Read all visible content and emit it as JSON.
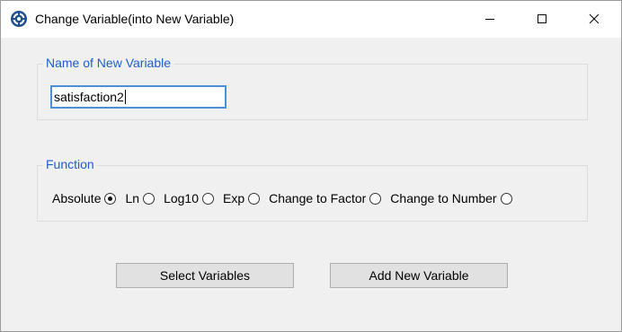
{
  "window": {
    "title": "Change Variable(into New Variable)",
    "icon": "app-gear-icon",
    "controls": [
      "minimize-icon",
      "maximize-icon",
      "close-icon"
    ]
  },
  "name_group": {
    "legend": "Name of New Variable",
    "input_value": "satisfaction2"
  },
  "function_group": {
    "legend": "Function",
    "options": [
      {
        "label": "Absolute",
        "checked": true
      },
      {
        "label": "Ln",
        "checked": false
      },
      {
        "label": "Log10",
        "checked": false
      },
      {
        "label": "Exp",
        "checked": false
      },
      {
        "label": "Change to Factor",
        "checked": false
      },
      {
        "label": "Change to Number",
        "checked": false
      }
    ]
  },
  "buttons": {
    "select_variables": "Select Variables",
    "add_new_variable": "Add New Variable"
  },
  "colors": {
    "legend_text": "#1a5fd6",
    "input_border": "#4a90d9",
    "window_bg": "#f0f0f0"
  }
}
